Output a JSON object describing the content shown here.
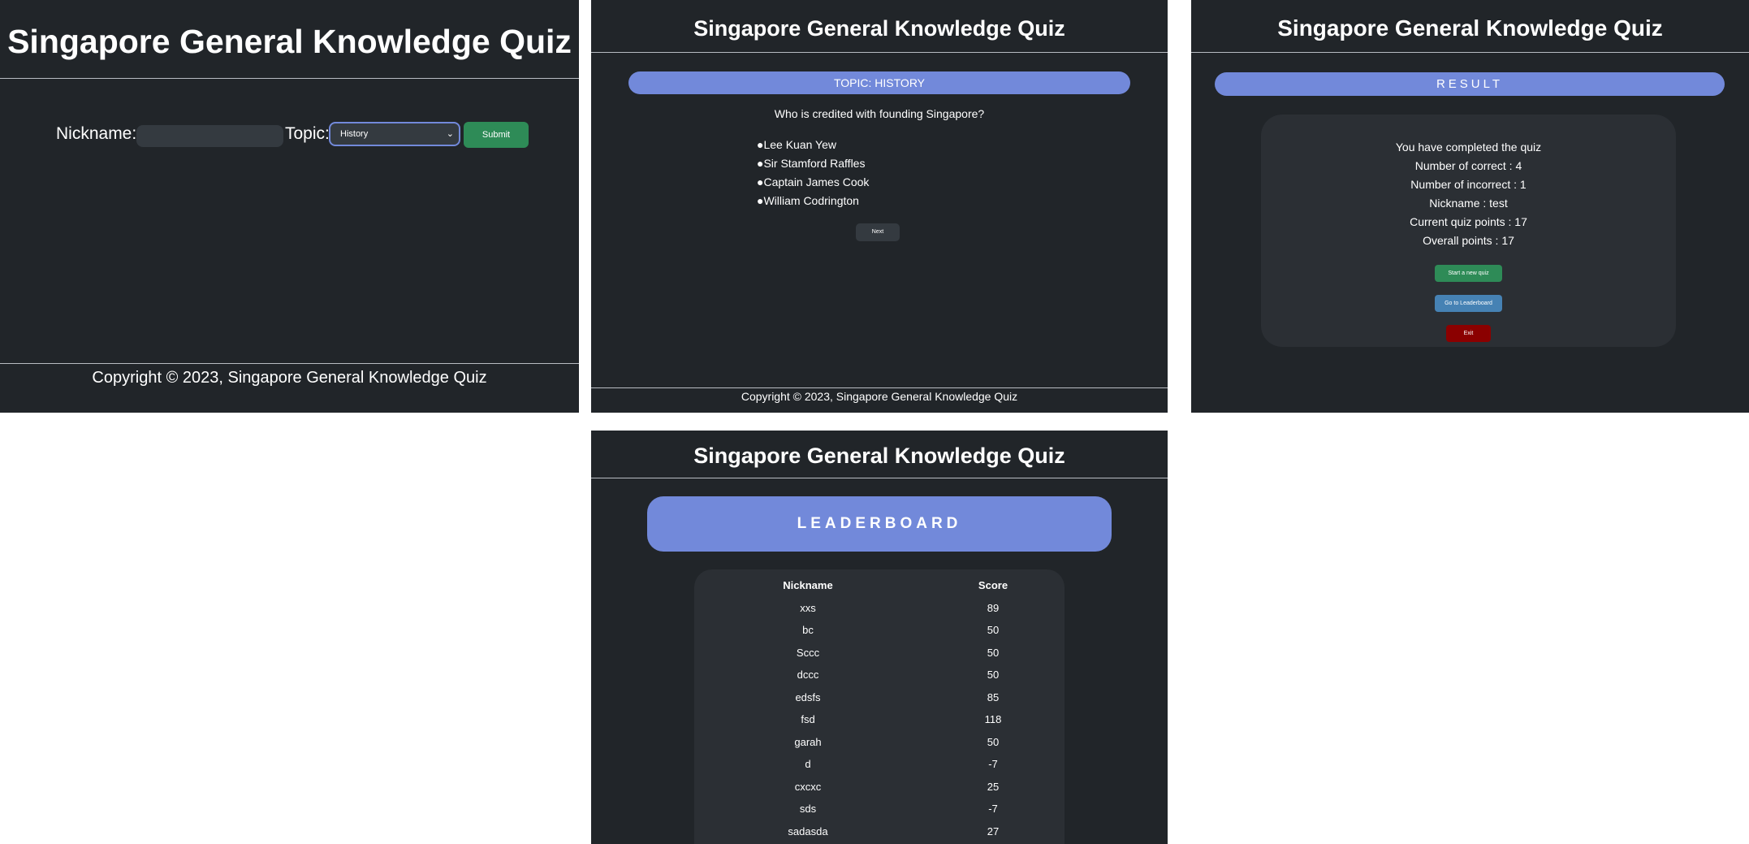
{
  "app_title": "Singapore General Knowledge Quiz",
  "footer_text": "Copyright © 2023, Singapore General Knowledge Quiz",
  "start_form": {
    "nickname_label": "Nickname:",
    "nickname_value": "",
    "topic_label": "Topic:",
    "topic_selected": "History",
    "submit_label": "Submit"
  },
  "question_page": {
    "topic_heading": "TOPIC: HISTORY",
    "question": "Who is credited with founding Singapore?",
    "options": [
      "●Lee Kuan Yew",
      "●Sir Stamford Raffles",
      "●Captain James Cook",
      "●William Codrington"
    ],
    "next_label": "Next"
  },
  "result_page": {
    "heading": "RESULT",
    "completed_text": "You have completed the quiz",
    "correct_text": "Number of correct : 4",
    "incorrect_text": "Number of incorrect : 1",
    "nickname_text": "Nickname : test",
    "current_points_text": "Current quiz points : 17",
    "overall_points_text": "Overall points : 17",
    "new_quiz_label": "Start a new quiz",
    "leaderboard_label": "Go to Leaderboard",
    "exit_label": "Exit"
  },
  "leaderboard_page": {
    "heading": "LEADERBOARD",
    "columns": [
      "Nickname",
      "Score"
    ],
    "rows": [
      [
        "xxs",
        "89"
      ],
      [
        "bc",
        "50"
      ],
      [
        "Sccc",
        "50"
      ],
      [
        "dccc",
        "50"
      ],
      [
        "edsfs",
        "85"
      ],
      [
        "fsd",
        "118"
      ],
      [
        "garah",
        "50"
      ],
      [
        "d",
        "-7"
      ],
      [
        "cxcxc",
        "25"
      ],
      [
        "sds",
        "-7"
      ],
      [
        "sadasda",
        "27"
      ]
    ]
  },
  "colors": {
    "background": "#212529",
    "accent": "#7289da",
    "submit": "#2e8b57",
    "leaderboard_button": "#4682b4",
    "exit_button": "#8b0000"
  }
}
